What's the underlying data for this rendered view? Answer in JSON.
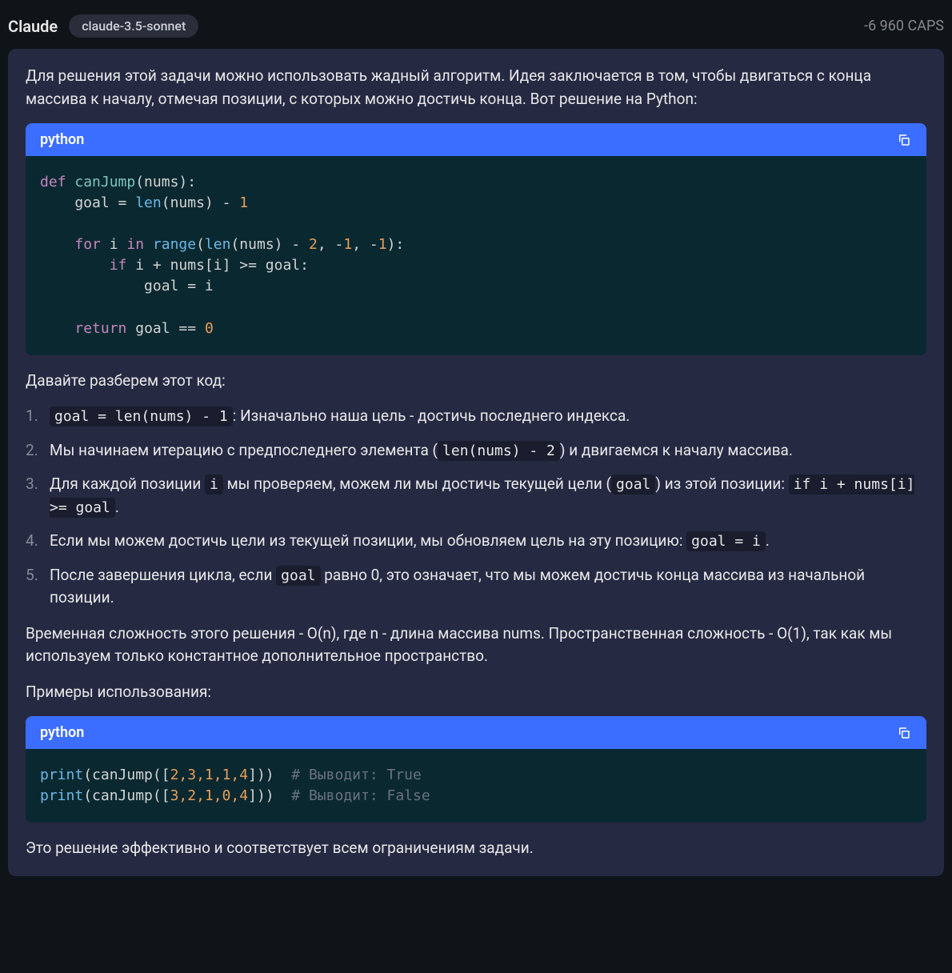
{
  "header": {
    "app_name": "Claude",
    "model": "claude-3.5-sonnet",
    "caps": "-6 960 CAPS"
  },
  "message": {
    "intro": "Для решения этой задачи можно использовать жадный алгоритм. Идея заключается в том, чтобы двигаться с конца массива к началу, отмечая позиции, с которых можно достичь конца. Вот решение на Python:",
    "code1_lang": "python",
    "code1_lines": {
      "l1_def": "def ",
      "l1_name": "canJump",
      "l1_rest": "(nums):",
      "l2_pre": "    goal = ",
      "l2_len": "len",
      "l2_rest_a": "(nums) - ",
      "l2_num": "1",
      "l3": "",
      "l4_pre": "    ",
      "l4_for": "for",
      "l4_i": " i ",
      "l4_in": "in",
      "l4_sp": " ",
      "l4_range": "range",
      "l4_op": "(",
      "l4_len": "len",
      "l4_a": "(nums) - ",
      "l4_n2": "2",
      "l4_b": ", -",
      "l4_n1a": "1",
      "l4_c": ", -",
      "l4_n1b": "1",
      "l4_d": "):",
      "l5_pre": "        ",
      "l5_if": "if",
      "l5_rest": " i + nums[i] >= goal:",
      "l6": "            goal = i",
      "l7": "",
      "l8_pre": "    ",
      "l8_ret": "return",
      "l8_rest_a": " goal == ",
      "l8_num": "0"
    },
    "explain_intro": "Давайте разберем этот код:",
    "steps": {
      "s1_code": "goal = len(nums) - 1",
      "s1_text": ": Изначально наша цель - достичь последнего индекса.",
      "s2_a": "Мы начинаем итерацию с предпоследнего элемента (",
      "s2_code": "len(nums) - 2",
      "s2_b": ") и двигаемся к началу массива.",
      "s3_a": "Для каждой позиции ",
      "s3_code_i": "i",
      "s3_b": " мы проверяем, можем ли мы достичь текущей цели (",
      "s3_code_goal": "goal",
      "s3_c": ") из этой позиции: ",
      "s3_code_cond": "if i + nums[i] >= goal",
      "s3_d": ".",
      "s4_a": "Если мы можем достичь цели из текущей позиции, мы обновляем цель на эту позицию: ",
      "s4_code": "goal = i",
      "s4_b": ".",
      "s5_a": "После завершения цикла, если ",
      "s5_code": "goal",
      "s5_b": " равно 0, это означает, что мы можем достичь конца массива из начальной позиции."
    },
    "complexity": "Временная сложность этого решения - O(n), где n - длина массива nums. Пространственная сложность - O(1), так как мы используем только константное дополнительное пространство.",
    "examples_intro": "Примеры использования:",
    "code2_lang": "python",
    "code2": {
      "l1_print": "print",
      "l1_a": "(canJump([",
      "l1_nums": "2,3,1,1,4",
      "l1_b": "]))  ",
      "l1_comment": "# Выводит: True",
      "l2_print": "print",
      "l2_a": "(canJump([",
      "l2_nums": "3,2,1,0,4",
      "l2_b": "]))  ",
      "l2_comment": "# Выводит: False"
    },
    "outro": "Это решение эффективно и соответствует всем ограничениям задачи."
  }
}
